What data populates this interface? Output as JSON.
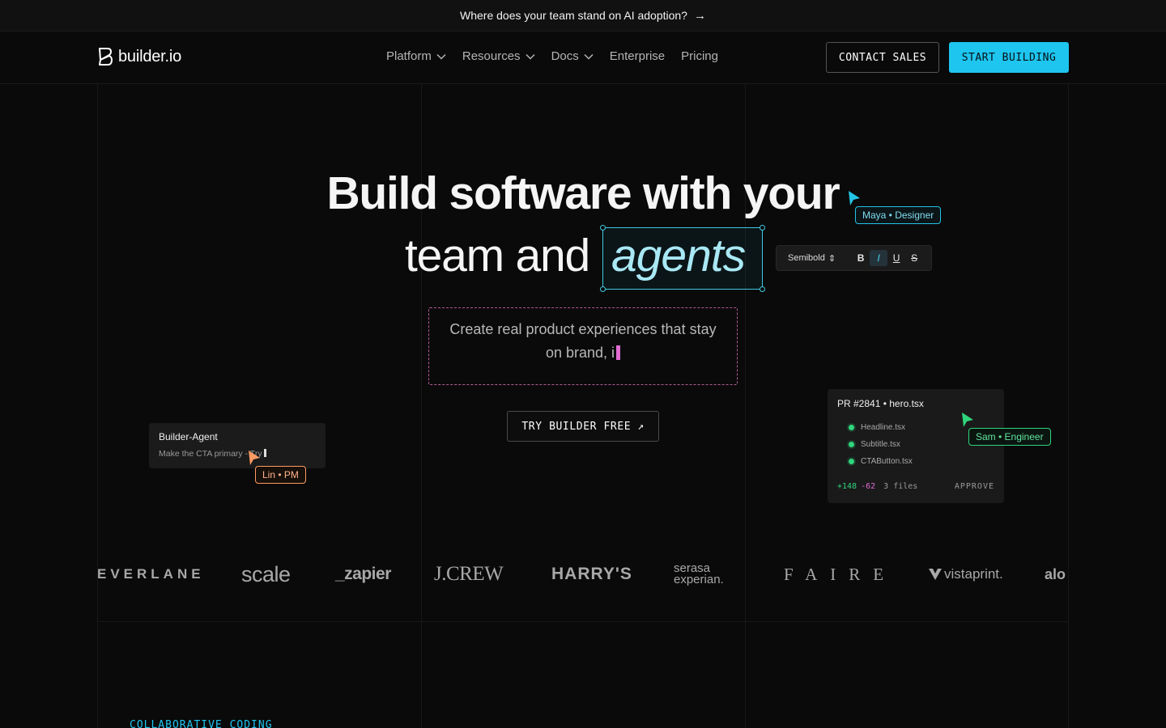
{
  "announcement": {
    "text": "Where does your team stand on AI adoption?",
    "arrow": "→"
  },
  "header": {
    "logo_text": "builder.io",
    "nav": [
      {
        "label": "Platform",
        "has_dropdown": true
      },
      {
        "label": "Resources",
        "has_dropdown": true
      },
      {
        "label": "Docs",
        "has_dropdown": true
      },
      {
        "label": "Enterprise",
        "has_dropdown": false
      },
      {
        "label": "Pricing",
        "has_dropdown": false
      }
    ],
    "contact_label": "CONTACT SALES",
    "start_label": "START BUILDING"
  },
  "hero": {
    "line1": "Build software with your",
    "line2_prefix": "team and",
    "line2_highlight": "agents",
    "subtitle_line1": "Create real product experiences that stay",
    "subtitle_line2": "on brand, i",
    "cta_label": "TRY BUILDER FREE",
    "cta_arrow": "↗"
  },
  "collaborators": {
    "maya": "Maya • Designer",
    "lin": "Lin • PM",
    "sam": "Sam • Engineer"
  },
  "format_toolbar": {
    "weight_label": "Semibold",
    "weight_arrows": "⇕",
    "bold": "B",
    "italic": "I",
    "underline": "U",
    "strike": "S"
  },
  "agent_card": {
    "title": "Builder-Agent",
    "prompt": "Make the CTA primary - Try"
  },
  "pr_card": {
    "title": "PR #2841 • hero.tsx",
    "files": [
      "Headline.tsx",
      "Subtitle.tsx",
      "CTAButton.tsx"
    ],
    "additions": "+148",
    "deletions": "-62",
    "file_count": "3 files",
    "approve_label": "APPROVE"
  },
  "logos": {
    "everlane": "EVERLANE",
    "scale": "scale",
    "zapier": "_zapier",
    "jcrew": "J.CREW",
    "harrys": "HARRY'S",
    "serasa_top": "serasa",
    "serasa_bottom": "experian.",
    "faire": "FAIRE",
    "vistaprint": "vistaprint.",
    "alo": "alo"
  },
  "section_label": "COLLABORATIVE CODING",
  "colors": {
    "accent_cyan": "#1ec5ef",
    "accent_pink": "#e06bd1",
    "accent_green": "#2fd57c",
    "accent_orange": "#ff9a62",
    "background": "#0a0a0a"
  },
  "icons": [
    "builder-logo-icon",
    "chevron-down-icon",
    "arrow-right-icon",
    "arrow-up-right-icon",
    "cursor-icon"
  ]
}
